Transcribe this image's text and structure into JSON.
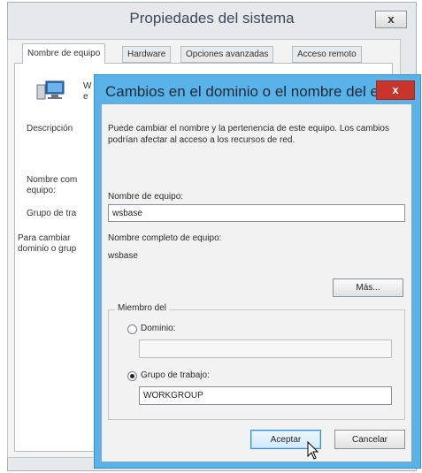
{
  "background_window": {
    "title": "Propiedades del sistema",
    "close_glyph": "x",
    "tabs": [
      "Nombre de equipo",
      "Hardware",
      "Opciones avanzadas",
      "Acceso remoto"
    ],
    "partial_texts": {
      "line1": "W",
      "line2": "e",
      "descripcion": "Descripción",
      "nombre_com": "Nombre com",
      "equipo": "equipo:",
      "grupo": "Grupo de tra",
      "para_cambiar": "Para cambiar",
      "dominio_grup": "dominio o grup"
    }
  },
  "dialog": {
    "title": "Cambios en el dominio o el nombre del e...",
    "close_glyph": "x",
    "info_text": "Puede cambiar el nombre y la pertenencia de este equipo. Los cambios podrían afectar al acceso a los recursos de red.",
    "computer_name_label": "Nombre de equipo:",
    "computer_name_value": "wsbase",
    "full_name_label": "Nombre completo de equipo:",
    "full_name_value": "wsbase",
    "more_button": "Más...",
    "member_of_label": "Miembro del",
    "domain_radio_label": "Dominio:",
    "domain_value": "",
    "workgroup_radio_label": "Grupo de trabajo:",
    "workgroup_value": "WORKGROUP",
    "selected_membership": "workgroup",
    "ok_button": "Aceptar",
    "cancel_button": "Cancelar"
  },
  "colors": {
    "dialog_frame": "#5ab3e8",
    "close_button": "#c9352b",
    "background_title": "#3b4a5c"
  }
}
